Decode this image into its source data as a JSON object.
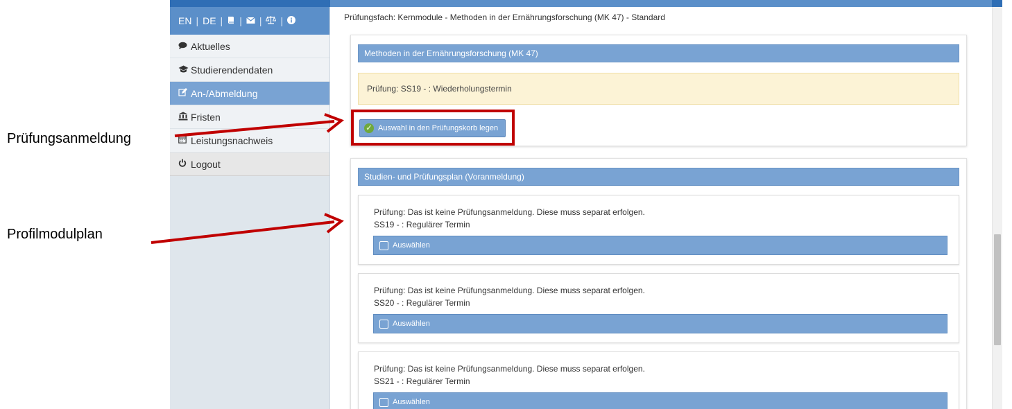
{
  "annotations": {
    "label_1": "Prüfungsanmeldung",
    "label_2": "Profilmodulplan"
  },
  "lang_bar": {
    "en": "EN",
    "de": "DE",
    "separator": "|",
    "icons": [
      "book-icon",
      "envelope-icon",
      "balance-scale-icon",
      "info-icon"
    ]
  },
  "sidebar": {
    "items": [
      {
        "label": "Aktuelles",
        "icon": "comment-icon"
      },
      {
        "label": "Studierendendaten",
        "icon": "graduation-cap-icon"
      },
      {
        "label": "An-/Abmeldung",
        "icon": "edit-icon",
        "active": true
      },
      {
        "label": "Fristen",
        "icon": "institution-icon"
      },
      {
        "label": "Leistungsnachweis",
        "icon": "calendar-icon"
      },
      {
        "label": "Logout",
        "icon": "power-icon"
      }
    ]
  },
  "main": {
    "breadcrumb": "Prüfungsfach: Kernmodule - Methoden in der Ernährungsforschung (MK 47) - Standard",
    "module_card": {
      "title": "Methoden in der Ernährungsforschung (MK 47)",
      "alert": "Prüfung: SS19 - : Wiederholungstermin",
      "basket_button": "Auswahl in den Prüfungskorb legen"
    },
    "plan_card": {
      "title": "Studien- und Prüfungsplan (Voranmeldung)",
      "entries": [
        {
          "line1": "Prüfung: Das ist keine Prüfungsanmeldung. Diese muss separat erfolgen.",
          "line2": "SS19 - : Regulärer Termin",
          "select_label": "Auswählen"
        },
        {
          "line1": "Prüfung: Das ist keine Prüfungsanmeldung. Diese muss separat erfolgen.",
          "line2": "SS20 - : Regulärer Termin",
          "select_label": "Auswählen"
        },
        {
          "line1": "Prüfung: Das ist keine Prüfungsanmeldung. Diese muss separat erfolgen.",
          "line2": "SS21 - : Regulärer Termin",
          "select_label": "Auswählen"
        }
      ]
    }
  },
  "colors": {
    "accent_blue": "#79a3d3",
    "header_blue": "#5b8fc9",
    "alert_yellow": "#fcf3d6",
    "annotation_red": "#c00000"
  }
}
